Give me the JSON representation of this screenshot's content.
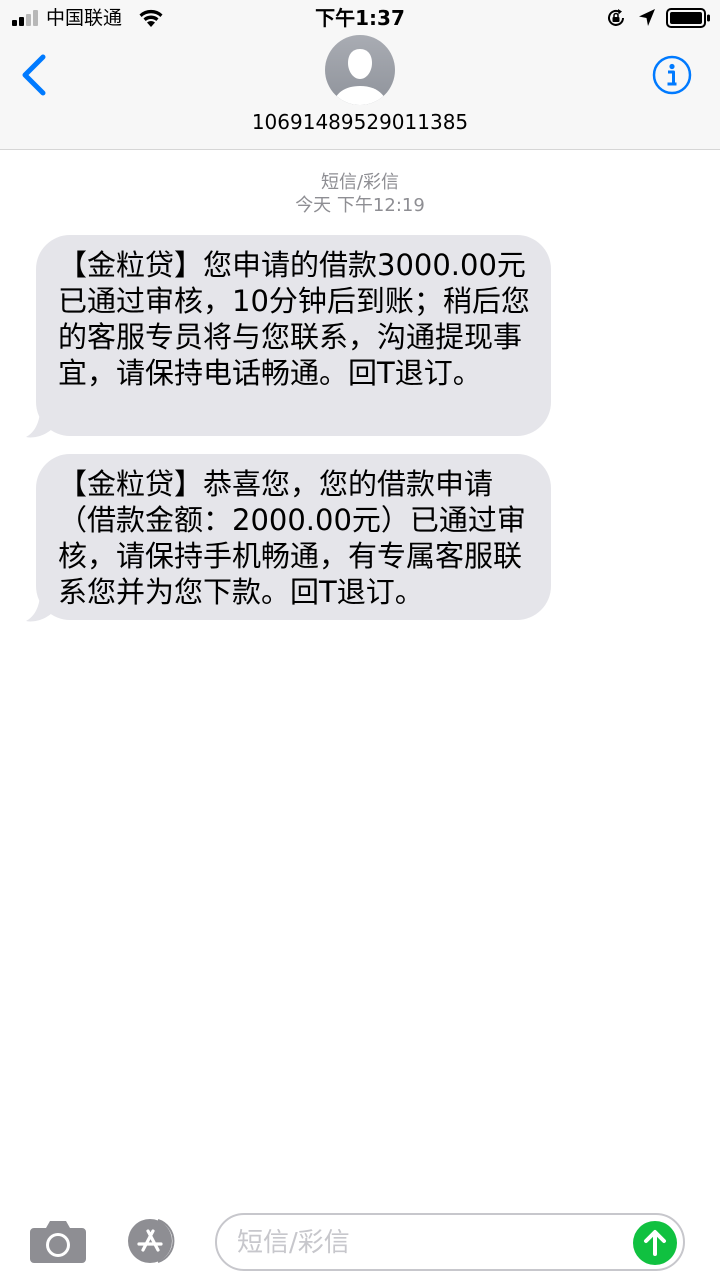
{
  "status_bar": {
    "carrier": "中国联通",
    "time": "下午1:37",
    "icons": [
      "signal-icon",
      "wifi-icon",
      "orientation-lock-icon",
      "location-arrow-icon",
      "battery-icon"
    ]
  },
  "header": {
    "back_icon": "chevron-left-icon",
    "avatar_icon": "person-silhouette-icon",
    "contact_number": "10691489529011385",
    "info_icon": "info-icon",
    "accent_color": "#007aff"
  },
  "conversation": {
    "message_type": "短信/彩信",
    "timestamp": "今天 下午12:19",
    "bubble_color": "#e5e5ea",
    "messages": [
      {
        "text": "【金粒贷】您申请的借款3000.00元已通过审核，10分钟后到账；稍后您的客服专员将与您联系，沟通提现事宜，请保持电话畅通。回T退订。"
      },
      {
        "text": "【金粒贷】恭喜您，您的借款申请（借款金额：2000.00元）已通过审核，请保持手机畅通，有专属客服联系您并为您下款。回T退订。"
      }
    ]
  },
  "composer": {
    "camera_icon": "camera-icon",
    "apps_icon": "app-store-icon",
    "placeholder": "短信/彩信",
    "send_icon": "arrow-up-icon",
    "send_color": "#10c140"
  }
}
